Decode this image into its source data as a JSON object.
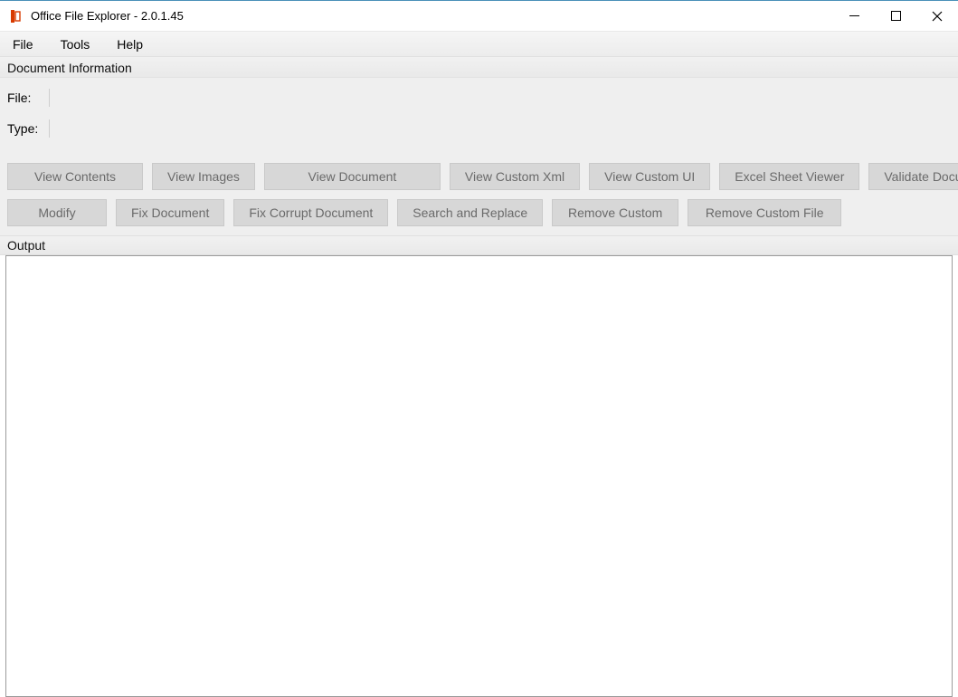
{
  "window": {
    "title": "Office File Explorer - 2.0.1.45"
  },
  "menu": {
    "file": "File",
    "tools": "Tools",
    "help": "Help"
  },
  "doc_info": {
    "header": "Document Information",
    "file_label": "File:",
    "file_value": "",
    "type_label": "Type:",
    "type_value": ""
  },
  "buttons": {
    "row1": {
      "view_contents": "View Contents",
      "view_images": "View Images",
      "view_document": "View Document",
      "view_custom_xml": "View Custom Xml",
      "view_custom_ui": "View Custom UI",
      "excel_sheet_viewer": "Excel Sheet Viewer",
      "validate_document": "Validate Document"
    },
    "row2": {
      "modify": "Modify",
      "fix_document": "Fix Document",
      "fix_corrupt_document": "Fix Corrupt Document",
      "search_and_replace": "Search and Replace",
      "remove_custom": "Remove Custom",
      "remove_custom_file": "Remove Custom File"
    }
  },
  "output": {
    "header": "Output",
    "content": ""
  }
}
